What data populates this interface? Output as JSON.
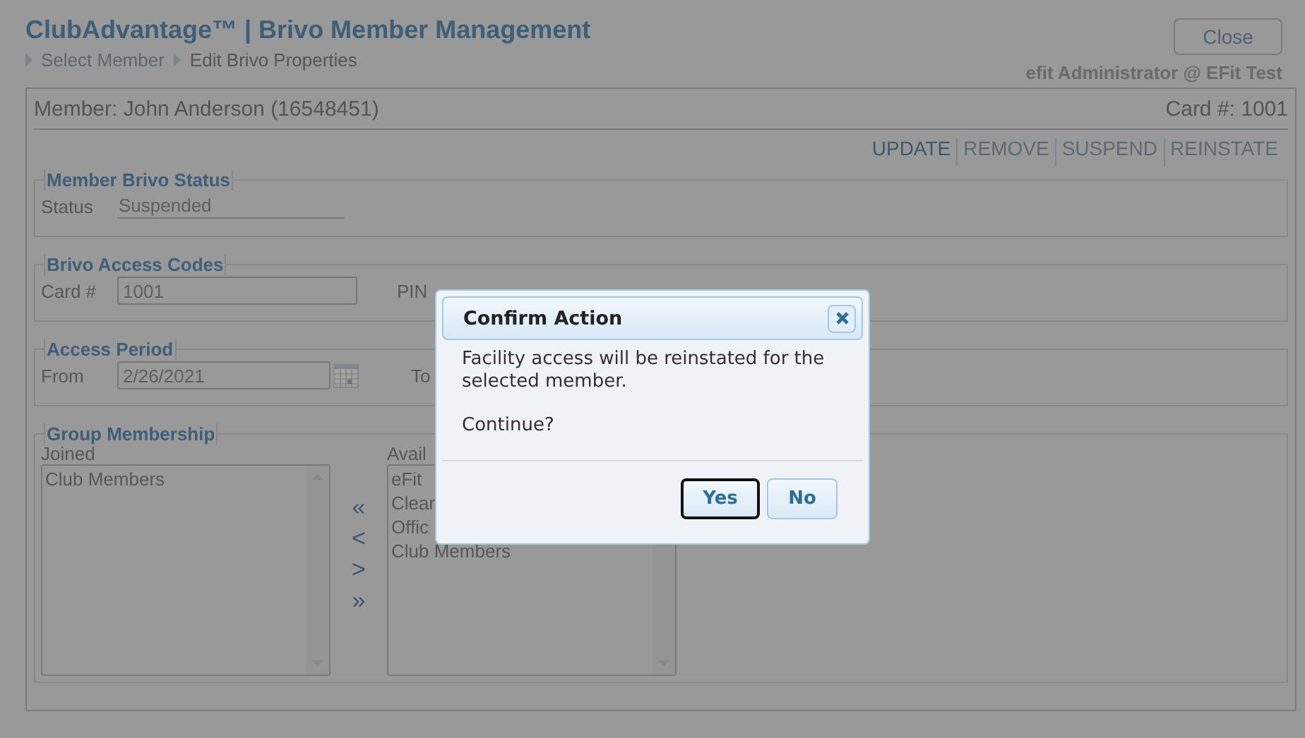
{
  "app_title": "ClubAdvantage™ | Brivo Member Management",
  "breadcrumb": [
    {
      "label": "Select Member",
      "current": false
    },
    {
      "label": "Edit Brivo Properties",
      "current": true
    }
  ],
  "close_button": "Close",
  "user": "efit Administrator @ EFit Test",
  "member": "Member: John Anderson (16548451)",
  "card": "Card #: 1001",
  "actions": [
    {
      "label": "UPDATE",
      "disabled": false
    },
    {
      "label": "REMOVE",
      "disabled": true
    },
    {
      "label": "SUSPEND",
      "disabled": true
    },
    {
      "label": "REINSTATE",
      "disabled": true
    }
  ],
  "status_section": {
    "legend": "Member Brivo Status",
    "label": "Status",
    "value": "Suspended"
  },
  "codes_section": {
    "legend": "Brivo Access Codes",
    "card_label": "Card #",
    "card_value": "1001",
    "pin_label": "PIN"
  },
  "period_section": {
    "legend": "Access Period",
    "from_label": "From",
    "from_value": "2/26/2021",
    "to_label": "To"
  },
  "group_section": {
    "legend": "Group Membership",
    "joined_label": "Joined",
    "joined": [
      "Club Members"
    ],
    "available_label": "Avail",
    "available": [
      "eFit",
      "Clear",
      "Offic",
      "Club Members"
    ],
    "move_buttons": [
      "«",
      "<",
      ">",
      "»"
    ]
  },
  "dialog": {
    "title": "Confirm Action",
    "message": "Facility access will be reinstated for the selected member.",
    "question": "Continue?",
    "buttons": [
      {
        "label": "Yes",
        "focused": true
      },
      {
        "label": "No",
        "focused": false
      }
    ]
  }
}
